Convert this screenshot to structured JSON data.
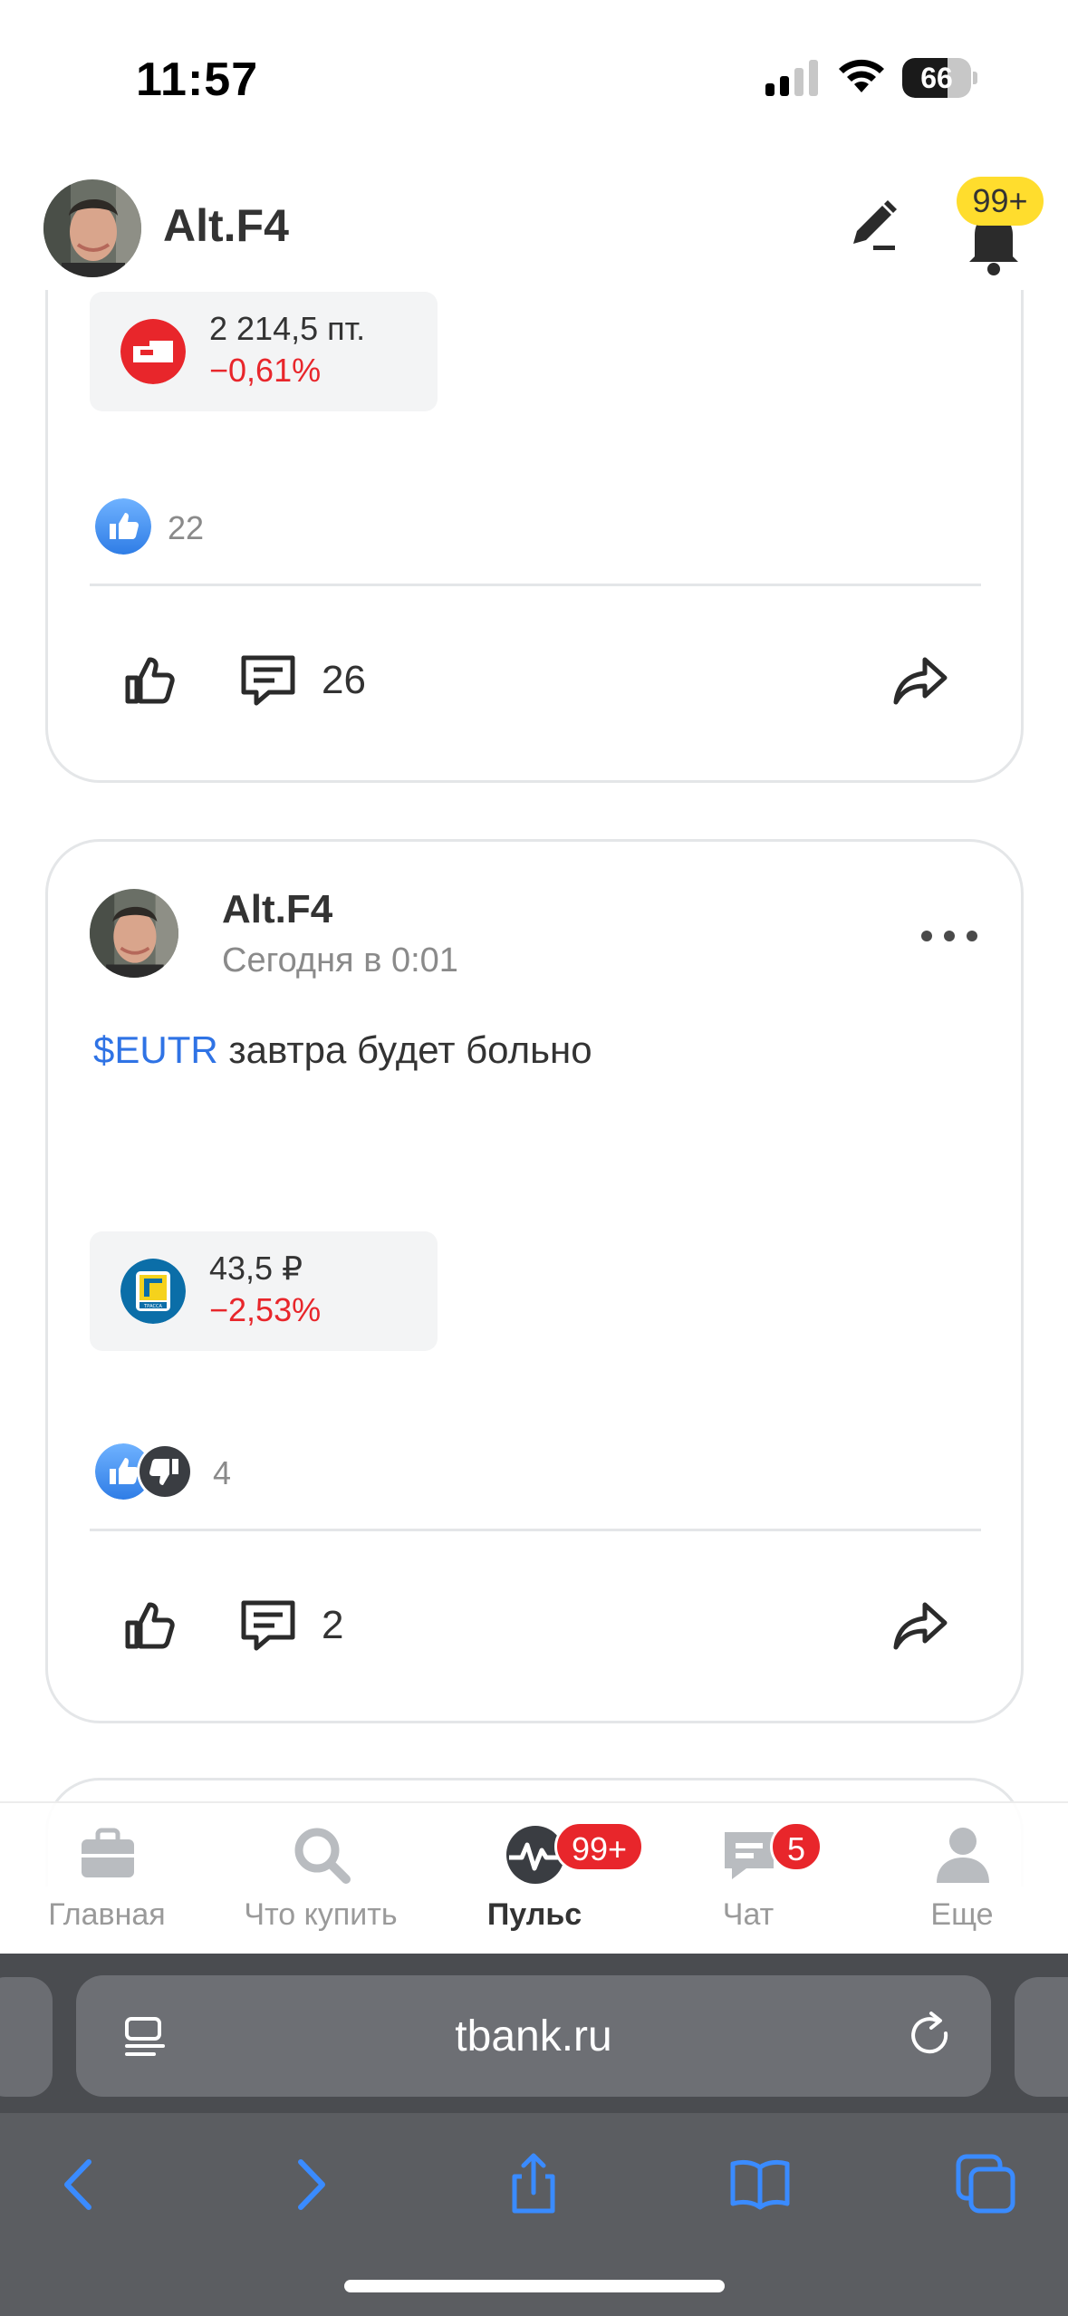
{
  "status_bar": {
    "time": "11:57",
    "battery": "66",
    "battery_level": 0.66
  },
  "header": {
    "user_name": "Alt.F4",
    "notifications_badge": "99+",
    "icons": [
      "avatar",
      "pencil-icon",
      "bell-icon"
    ]
  },
  "prev_post": {
    "ticker": {
      "price": "2 214,5 пт.",
      "change": "−0,61%"
    },
    "likes_count": "22",
    "comments_count": "26"
  },
  "post": {
    "author": "Alt.F4",
    "date": "Сегодня в 0:01",
    "ticker_link": "$EUTR",
    "text": " завтра будет больно",
    "ticker": {
      "price": "43,5 ₽",
      "change": "−2,53%",
      "logo_text": "ТРАССА"
    },
    "reactions_count": "4",
    "comments_count": "2"
  },
  "tab_bar": {
    "tabs": [
      {
        "label": "Главная",
        "icon": "briefcase-icon"
      },
      {
        "label": "Что купить",
        "icon": "search-icon"
      },
      {
        "label": "Пульс",
        "icon": "pulse-icon",
        "badge": "99+",
        "active": true
      },
      {
        "label": "Чат",
        "icon": "chat-icon",
        "badge": "5"
      },
      {
        "label": "Еще",
        "icon": "profile-icon"
      }
    ]
  },
  "browser": {
    "url": "tbank.ru"
  },
  "colors": {
    "accent_yellow": "#ffdd2d",
    "negative_red": "#e8262b",
    "link_blue": "#2f73e5",
    "safari_gray": "#5b5d61"
  }
}
